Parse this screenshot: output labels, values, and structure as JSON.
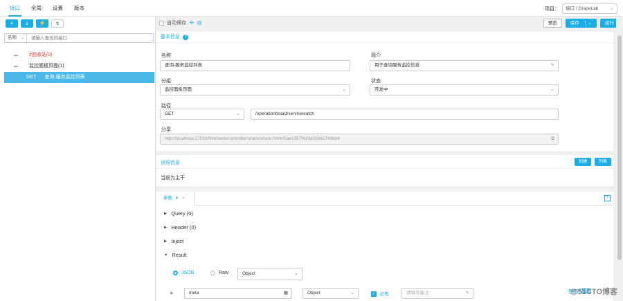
{
  "topnav": {
    "tabs": [
      "接口",
      "全局",
      "设置",
      "版本"
    ]
  },
  "project": {
    "label": "项目：",
    "value": "接口 / GrapeLab"
  },
  "sidebar": {
    "tools": [
      "+",
      "⇣",
      "⚡",
      "⇅"
    ],
    "search_label": "名称",
    "search_placeholder": "请输入查找的接口",
    "tree": [
      {
        "label": "#回收站(0)"
      },
      {
        "label": "监控面板页面(1)"
      },
      {
        "method": "GET",
        "label": "查询-服务监控列表"
      }
    ]
  },
  "toolbar": {
    "autosave": "自动保存",
    "preview": "预览",
    "save": "保存",
    "run": "运行"
  },
  "basic": {
    "title": "基本信息",
    "name_label": "名称",
    "name_value": "查询-服务监控列表",
    "desc_label": "简介",
    "desc_value": "用于查询服务监控信息",
    "group_label": "分组",
    "group_value": "监控面板页面",
    "status_label": "状态",
    "status_value": "开发中",
    "path_label": "路径",
    "method_value": "GET",
    "path_value": "/operationboard/servicewatch",
    "share_label": "分享",
    "share_value": "http://localhost:27016/html/web/controller/share/share.html#5ae1357f429d3366c749bb6"
  },
  "branch": {
    "title": "快照信息",
    "create": "创建",
    "list": "列表",
    "current": "当前为主干"
  },
  "params": {
    "tab": "参数",
    "sections": [
      "Query (0)",
      "Header (0)",
      "Inject",
      "Result"
    ],
    "json": "JSON",
    "raw": "Raw",
    "type": "Object",
    "mock": "mock规则",
    "row": {
      "name": "meta",
      "type": "Object",
      "required": "必有",
      "remark_placeholder": "请填写备注"
    }
  },
  "watermark": "@51CTO博客"
}
